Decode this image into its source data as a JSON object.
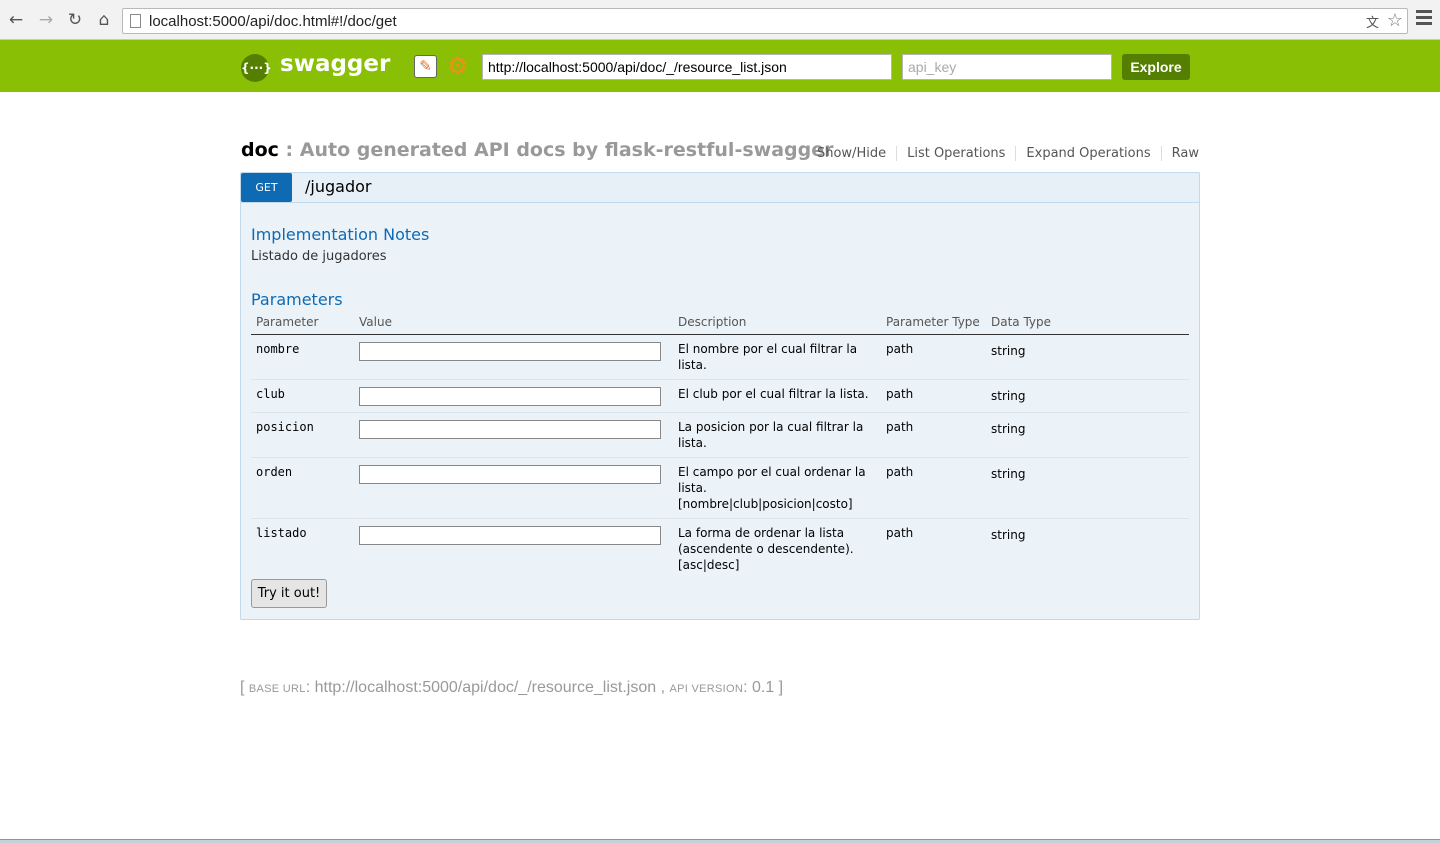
{
  "browser": {
    "address": "localhost:5000/api/doc.html#!/doc/get"
  },
  "header": {
    "logo_symbol": "{···}",
    "logo_text": "swagger",
    "url_value": "http://localhost:5000/api/doc/_/resource_list.json",
    "api_key_placeholder": "api_key",
    "explore_label": "Explore"
  },
  "resource": {
    "name": "doc",
    "separator": " : ",
    "description": "Auto generated API docs by flask-restful-swagger",
    "links": [
      "Show/Hide",
      "List Operations",
      "Expand Operations",
      "Raw"
    ]
  },
  "operation": {
    "method": "GET",
    "path": "/jugador",
    "impl_title": "Implementation Notes",
    "impl_text": "Listado de jugadores",
    "params_title": "Parameters",
    "columns": [
      "Parameter",
      "Value",
      "Description",
      "Parameter Type",
      "Data Type"
    ],
    "params": [
      {
        "name": "nombre",
        "value": "",
        "description": "El nombre por el cual filtrar la lista.",
        "options": "",
        "param_type": "path",
        "data_type": "string"
      },
      {
        "name": "club",
        "value": "",
        "description": "El club por el cual filtrar la lista.",
        "options": "",
        "param_type": "path",
        "data_type": "string"
      },
      {
        "name": "posicion",
        "value": "",
        "description": "La posicion por la cual filtrar la lista.",
        "options": "",
        "param_type": "path",
        "data_type": "string"
      },
      {
        "name": "orden",
        "value": "",
        "description": "El campo por el cual ordenar la lista.",
        "options": "[nombre|club|posicion|costo]",
        "param_type": "path",
        "data_type": "string"
      },
      {
        "name": "listado",
        "value": "",
        "description": "La forma de ordenar la lista (ascendente o descendente).",
        "options": "[asc|desc]",
        "param_type": "path",
        "data_type": "string"
      }
    ],
    "try_label": "Try it out!"
  },
  "footer": {
    "open": "[ ",
    "base_url_label": "base url",
    "base_url": "http://localhost:5000/api/doc/_/resource_list.json",
    "comma": " , ",
    "api_version_label": "api version",
    "api_version": "0.1",
    "close": " ]"
  },
  "colors": {
    "header_bg": "#89bf04",
    "header_dark": "#547f00",
    "get_blue": "#0f6ab4",
    "op_bg": "#ebf3f9"
  }
}
